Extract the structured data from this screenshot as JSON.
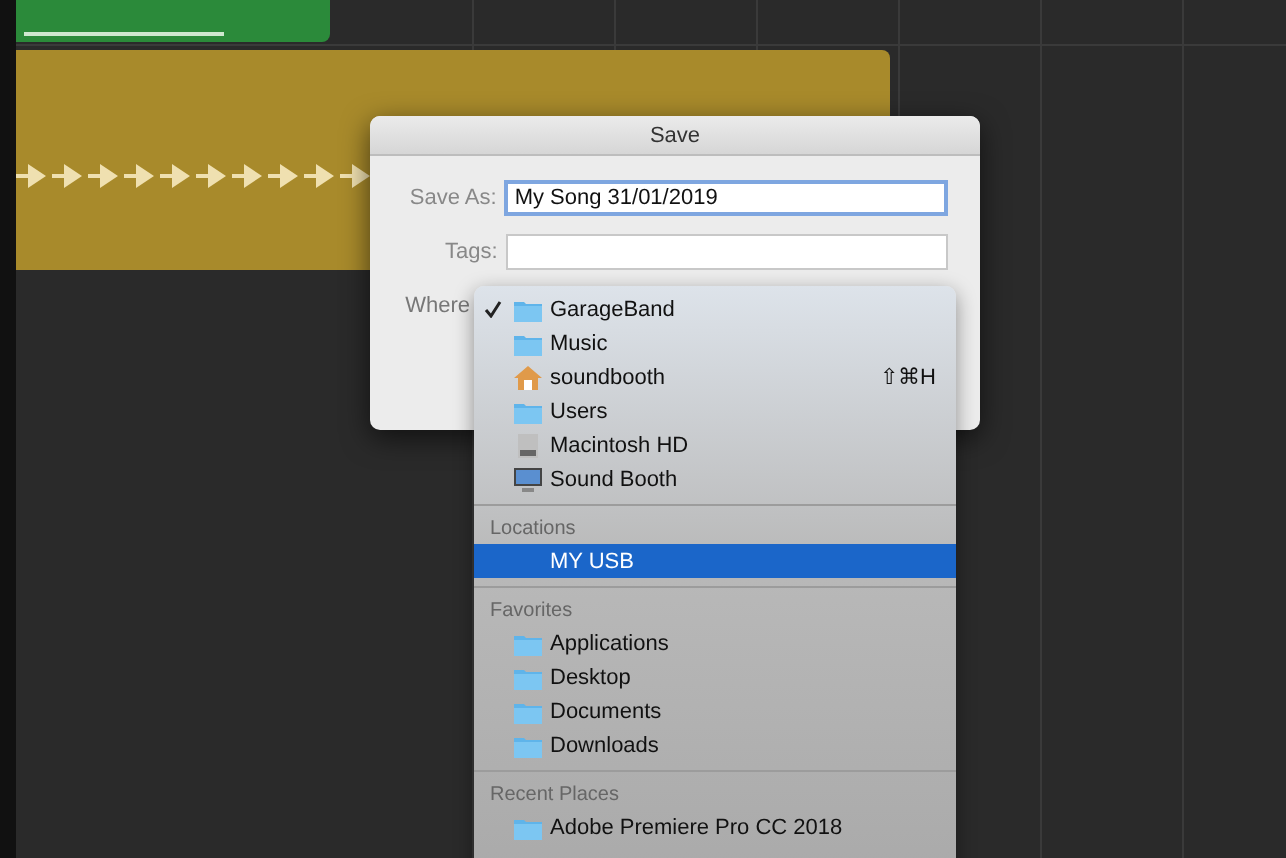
{
  "dialog": {
    "title": "Save",
    "fields": [
      {
        "label": "Save As:",
        "value": "My Song 31/01/2019",
        "focused": true
      },
      {
        "label": "Tags:",
        "focused": false
      }
    ],
    "where_label": "Where"
  },
  "menu": {
    "sections": [
      {
        "items": [
          {
            "label": "GarageBand",
            "kind": "folder",
            "checked": true,
            "selected": false
          },
          {
            "label": "Music",
            "kind": "folder",
            "checked": false,
            "selected": false
          },
          {
            "label": "soundbooth",
            "kind": "home",
            "checked": false,
            "selected": false,
            "shortcut": "⇧⌘H"
          },
          {
            "label": "Users",
            "kind": "folder",
            "checked": false,
            "selected": false
          },
          {
            "label": "Macintosh HD",
            "kind": "drive",
            "checked": false,
            "selected": false
          },
          {
            "label": "Sound Booth",
            "kind": "computer",
            "checked": false,
            "selected": false
          }
        ]
      },
      {
        "header": "Locations",
        "items": [
          {
            "label": "MY USB",
            "kind": "none",
            "checked": false,
            "selected": true
          }
        ]
      },
      {
        "header": "Favorites",
        "items": [
          {
            "label": "Applications",
            "kind": "folder",
            "checked": false,
            "selected": false
          },
          {
            "label": "Desktop",
            "kind": "folder",
            "checked": false,
            "selected": false
          },
          {
            "label": "Documents",
            "kind": "folder",
            "checked": false,
            "selected": false
          },
          {
            "label": "Downloads",
            "kind": "folder",
            "checked": false,
            "selected": false
          }
        ]
      },
      {
        "header": "Recent Places",
        "items": [
          {
            "label": "Adobe Premiere Pro CC 2018",
            "kind": "folder",
            "checked": false,
            "selected": false
          }
        ]
      }
    ]
  }
}
